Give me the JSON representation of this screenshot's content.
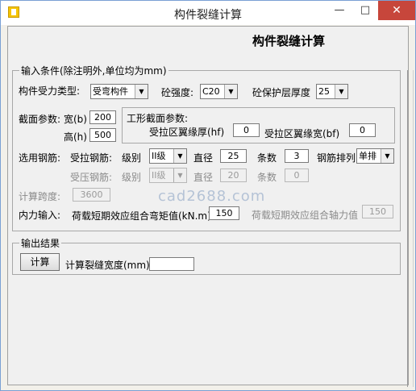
{
  "window": {
    "title": "构件裂缝计算",
    "min_label": "—",
    "max_label": "□",
    "close_label": "✕"
  },
  "heading": "构件裂缝计算",
  "input_group": {
    "legend": "输入条件(除注明外,单位均为mm)",
    "force_type_label": "构件受力类型:",
    "force_type_value": "受弯构件",
    "concrete_label": "砼强度:",
    "concrete_value": "C20",
    "cover_label": "砼保护层厚度",
    "cover_value": "25",
    "section_label": "截面参数:",
    "width_label": "宽(b)",
    "width_value": "200",
    "height_label": "高(h)",
    "height_value": "500",
    "tsection_label": "工形截面参数:",
    "hf_label": "受拉区翼缘厚(hf)",
    "hf_value": "0",
    "bf_label": "受拉区翼缘宽(bf)",
    "bf_value": "0",
    "rebar_label": "选用钢筋:",
    "tension_label": "受拉钢筋:",
    "grade_label": "级别",
    "grade_value": "II级",
    "diameter_label": "直径",
    "diameter_value": "25",
    "count_label": "条数",
    "count_value": "3",
    "arrangement_label": "钢筋排列",
    "arrangement_value": "单排",
    "compression_label": "受压钢筋:",
    "c_grade_label": "级别",
    "c_grade_value": "II级",
    "c_diameter_label": "直径",
    "c_diameter_value": "20",
    "c_count_label": "条数",
    "c_count_value": "0",
    "span_label": "计算跨度:",
    "span_value": "3600",
    "internal_label": "内力输入:",
    "moment_label": "荷载短期效应组合弯矩值(kN.m)",
    "moment_value": "150",
    "axial_label": "荷载短期效应组合轴力值",
    "axial_value": "150"
  },
  "output_group": {
    "legend": "输出结果",
    "calc_button": "计算",
    "crack_label": "计算裂缝宽度(mm)",
    "crack_value": ""
  },
  "watermark": "cad2688.com"
}
